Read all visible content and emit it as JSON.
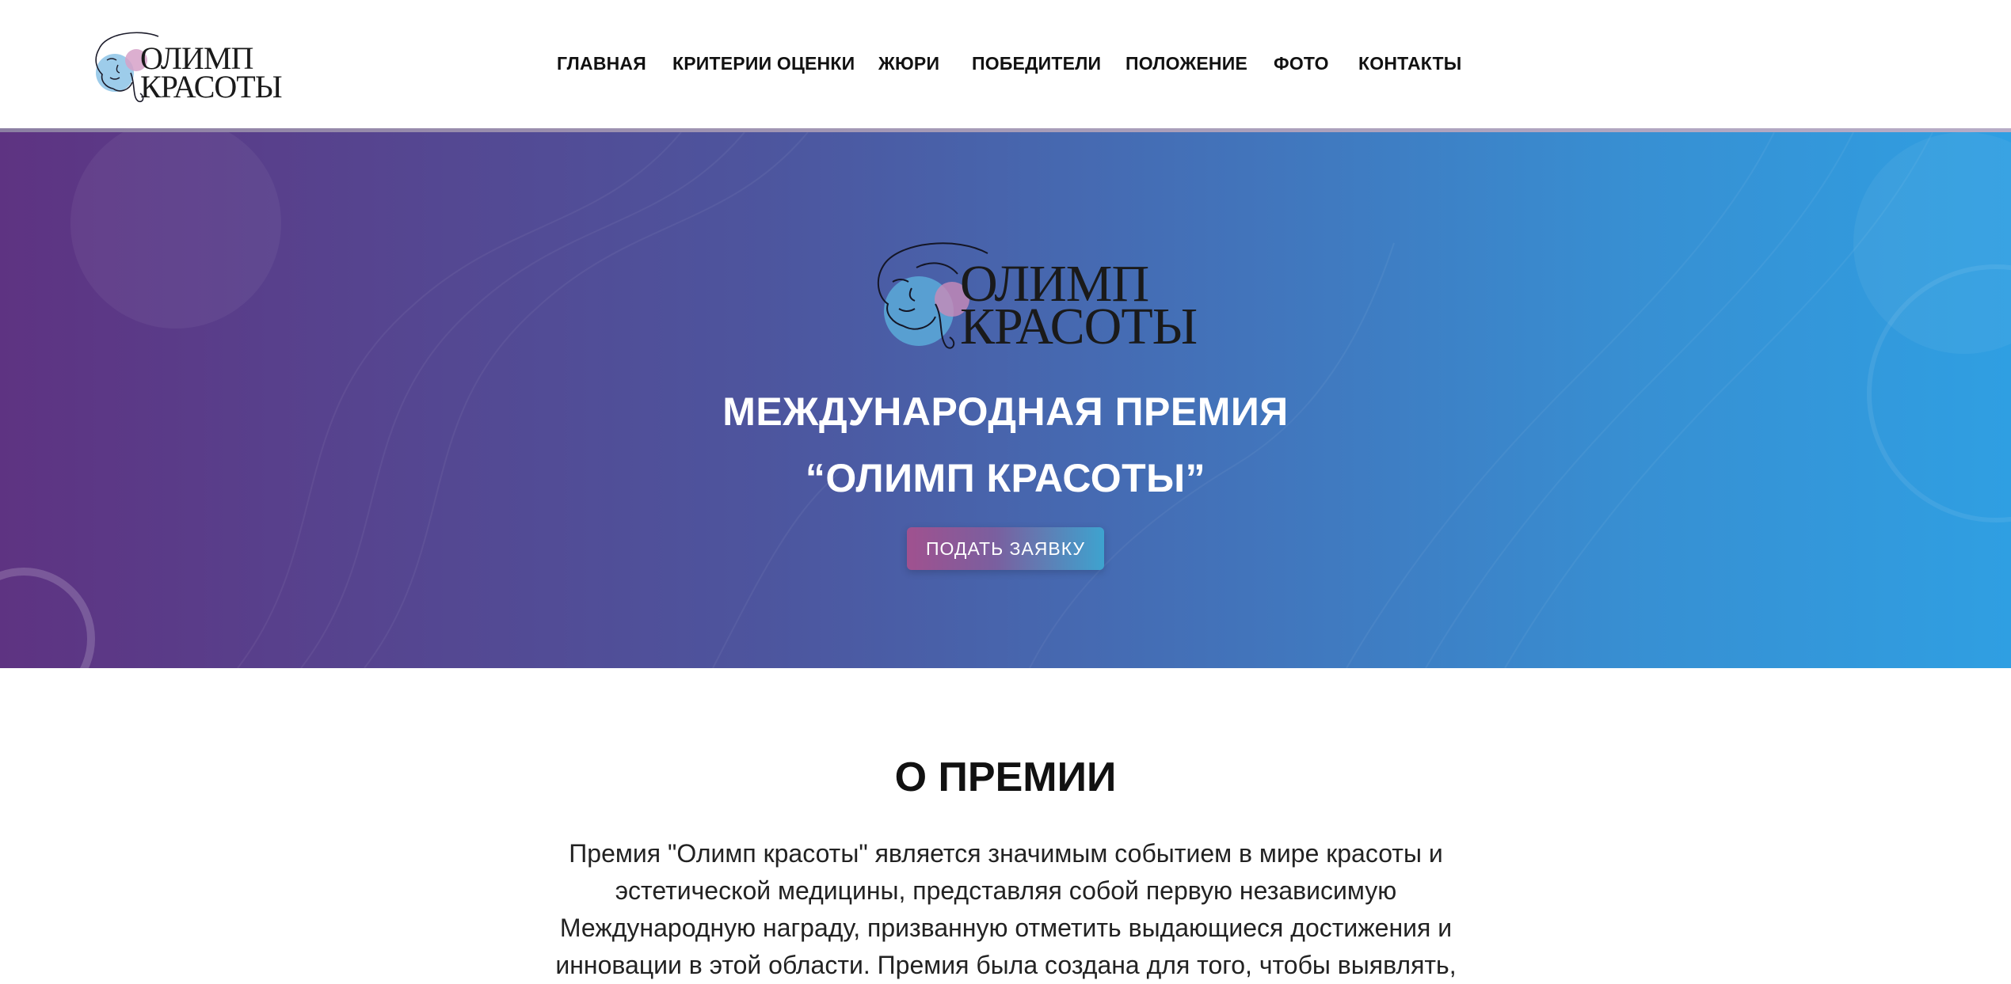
{
  "brand": {
    "logo_line1": "ОЛИМП",
    "logo_line2": "КРАСОТЫ",
    "logo_icon": "face-line-art-icon"
  },
  "nav": {
    "items": [
      {
        "label": "ГЛАВНАЯ"
      },
      {
        "label": "КРИТЕРИИ ОЦЕНКИ"
      },
      {
        "label": "ЖЮРИ"
      },
      {
        "label": "ПОБЕДИТЕЛИ"
      },
      {
        "label": "ПОЛОЖЕНИЕ"
      },
      {
        "label": "ФОТО"
      },
      {
        "label": "КОНТАКТЫ"
      }
    ]
  },
  "hero": {
    "title_line1": "МЕЖДУНАРОДНАЯ ПРЕМИЯ",
    "title_line2": "“ОЛИМП КРАСОТЫ”",
    "cta_label": "ПОДАТЬ ЗАЯВКУ"
  },
  "about": {
    "heading": "О ПРЕМИИ",
    "text": "Премия \"Олимп красоты\" является значимым событием в мире красоты и эстетической медицины, представляя собой первую независимую Международную награду, призванную отметить выдающиеся достижения и инновации в этой области. Премия была создана для того, чтобы выявлять,"
  },
  "colors": {
    "hero_gradient_start": "#5e3382",
    "hero_gradient_end": "#2f9fe2",
    "cta_gradient_start": "#a0518f",
    "cta_gradient_end": "#3ea3cf",
    "logo_blue": "#5aa6d6",
    "logo_pink": "#c98bb8"
  }
}
